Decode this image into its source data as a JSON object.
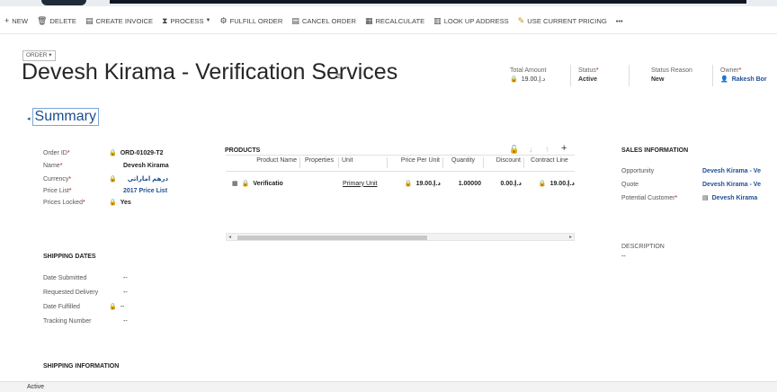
{
  "commands": [
    {
      "icon": "+",
      "label": "NEW"
    },
    {
      "icon": "🗑",
      "label": "DELETE"
    },
    {
      "icon": "▤",
      "label": "CREATE INVOICE"
    },
    {
      "icon": "⧗",
      "label": "PROCESS",
      "dropdown": true
    },
    {
      "icon": "⚙",
      "label": "FULFILL ORDER"
    },
    {
      "icon": "▤",
      "label": "CANCEL ORDER"
    },
    {
      "icon": "▦",
      "label": "RECALCULATE"
    },
    {
      "icon": "▥",
      "label": "LOOK UP ADDRESS"
    },
    {
      "icon": "✎",
      "label": "USE CURRENT PRICING"
    },
    {
      "icon": "",
      "label": "•••"
    }
  ],
  "entity_tag": "ORDER ▾",
  "title": "Devesh Kirama - Verification Services",
  "title_menu": "≡",
  "header": {
    "total_amount_label": "Total Amount",
    "total_amount_value": "د.إ.‏19.00",
    "status_label": "Status",
    "status_value": "Active",
    "status_reason_label": "Status Reason",
    "status_reason_value": "New",
    "owner_label": "Owner",
    "owner_value": "Rakesh Bor"
  },
  "summary_label": "Summary",
  "order": {
    "order_id_label": "Order ID",
    "order_id_value": "ORD-01029-T2",
    "name_label": "Name",
    "name_value": "Devesh Kirama",
    "currency_label": "Currency",
    "currency_value": "درهم اماراتي",
    "price_list_label": "Price List",
    "price_list_value": "2017 Price List",
    "prices_locked_label": "Prices Locked",
    "prices_locked_value": "Yes"
  },
  "shipping_dates": {
    "header": "SHIPPING DATES",
    "date_submitted_label": "Date Submitted",
    "date_submitted_value": "--",
    "requested_delivery_label": "Requested Delivery",
    "requested_delivery_value": "--",
    "date_fulfilled_label": "Date Fulfilled",
    "date_fulfilled_value": "--",
    "tracking_number_label": "Tracking Number",
    "tracking_number_value": "--"
  },
  "shipping_information_header": "SHIPPING INFORMATION",
  "products": {
    "header": "PRODUCTS",
    "columns": [
      "Product Name",
      "Properties",
      "Unit",
      "Price Per Unit",
      "Quantity",
      "Discount",
      "Contract Line"
    ],
    "rows": [
      {
        "product_name": "Verificatio",
        "properties": "",
        "unit": "Primary Unit",
        "price_per_unit": "د.إ.‏19.00",
        "quantity": "1.00000",
        "discount": "د.إ.‏0.00",
        "contract_line": "د.إ.‏19.00"
      }
    ]
  },
  "sales_information": {
    "header": "SALES INFORMATION",
    "opportunity_label": "Opportunity",
    "opportunity_value": "Devesh Kirama - Ve",
    "quote_label": "Quote",
    "quote_value": "Devesh Kirama - Ve",
    "potential_customer_label": "Potential Customer",
    "potential_customer_value": "Devesh Kirama"
  },
  "description": {
    "label": "DESCRIPTION",
    "value": "--"
  },
  "status_bar": "Active"
}
